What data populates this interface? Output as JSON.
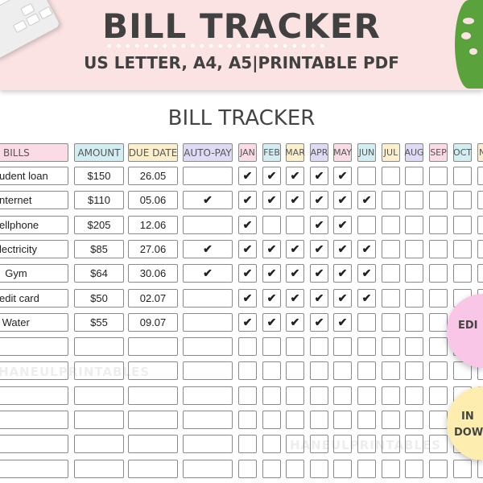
{
  "banner": {
    "title": "BILL TRACKER",
    "subtitle": "US LETTER, A4, A5|PRINTABLE PDF"
  },
  "sheet": {
    "title": "BILL TRACKER"
  },
  "columns": [
    {
      "label": "BILLS",
      "color": "#fadbe6"
    },
    {
      "label": "AMOUNT",
      "color": "#d3eef2"
    },
    {
      "label": "DUE DATE",
      "color": "#fcefcc"
    },
    {
      "label": "AUTO-PAY",
      "color": "#e0dbf5"
    }
  ],
  "months": [
    {
      "label": "JAN",
      "color": "#fadbe6"
    },
    {
      "label": "FEB",
      "color": "#d3eef2"
    },
    {
      "label": "MAR",
      "color": "#fcefcc"
    },
    {
      "label": "APR",
      "color": "#e0dbf5"
    },
    {
      "label": "MAY",
      "color": "#fadbe6"
    },
    {
      "label": "JUN",
      "color": "#d3eef2"
    },
    {
      "label": "JUL",
      "color": "#fcefcc"
    },
    {
      "label": "AUG",
      "color": "#e0dbf5"
    },
    {
      "label": "SEP",
      "color": "#fadbe6"
    },
    {
      "label": "OCT",
      "color": "#d3eef2"
    },
    {
      "label": "N",
      "color": "#fcefcc"
    }
  ],
  "check_symbol": "✔",
  "rows": [
    {
      "bill": "udent loan",
      "amount": "$150",
      "due": "26.05",
      "autopay": false,
      "paid": [
        1,
        1,
        1,
        1,
        1,
        0,
        0,
        0,
        0,
        0,
        0
      ]
    },
    {
      "bill": "nternet",
      "amount": "$110",
      "due": "05.06",
      "autopay": true,
      "paid": [
        1,
        1,
        1,
        1,
        1,
        1,
        0,
        0,
        0,
        0,
        0
      ]
    },
    {
      "bill": "ellphone",
      "amount": "$205",
      "due": "12.06",
      "autopay": false,
      "paid": [
        1,
        0,
        0,
        1,
        1,
        0,
        0,
        0,
        0,
        0,
        0
      ]
    },
    {
      "bill": "lectricity",
      "amount": "$85",
      "due": "27.06",
      "autopay": true,
      "paid": [
        1,
        1,
        1,
        1,
        1,
        1,
        0,
        0,
        0,
        0,
        0
      ]
    },
    {
      "bill": "  Gym",
      "amount": "$64",
      "due": "30.06",
      "autopay": true,
      "paid": [
        1,
        1,
        1,
        1,
        1,
        1,
        0,
        0,
        0,
        0,
        0
      ]
    },
    {
      "bill": "edit card",
      "amount": "$50",
      "due": "02.07",
      "autopay": false,
      "paid": [
        1,
        1,
        1,
        1,
        1,
        1,
        0,
        0,
        0,
        0,
        0
      ]
    },
    {
      "bill": " Water",
      "amount": "$55",
      "due": "09.07",
      "autopay": false,
      "paid": [
        1,
        1,
        1,
        1,
        1,
        0,
        0,
        0,
        0,
        0,
        0
      ]
    },
    {
      "bill": "",
      "amount": "",
      "due": "",
      "autopay": false,
      "paid": []
    },
    {
      "bill": "",
      "amount": "",
      "due": "",
      "autopay": false,
      "paid": []
    },
    {
      "bill": "",
      "amount": "",
      "due": "",
      "autopay": false,
      "paid": []
    },
    {
      "bill": "",
      "amount": "",
      "due": "",
      "autopay": false,
      "paid": []
    },
    {
      "bill": "",
      "amount": "",
      "due": "",
      "autopay": false,
      "paid": []
    },
    {
      "bill": "",
      "amount": "",
      "due": "",
      "autopay": false,
      "paid": []
    }
  ],
  "watermark": "HANEULPRINTABLES",
  "badges": [
    {
      "lines": [
        "EDI"
      ],
      "color": "#f9c6e8"
    },
    {
      "lines": [
        "IN",
        "DOW"
      ],
      "color": "#fdeeb0"
    }
  ]
}
